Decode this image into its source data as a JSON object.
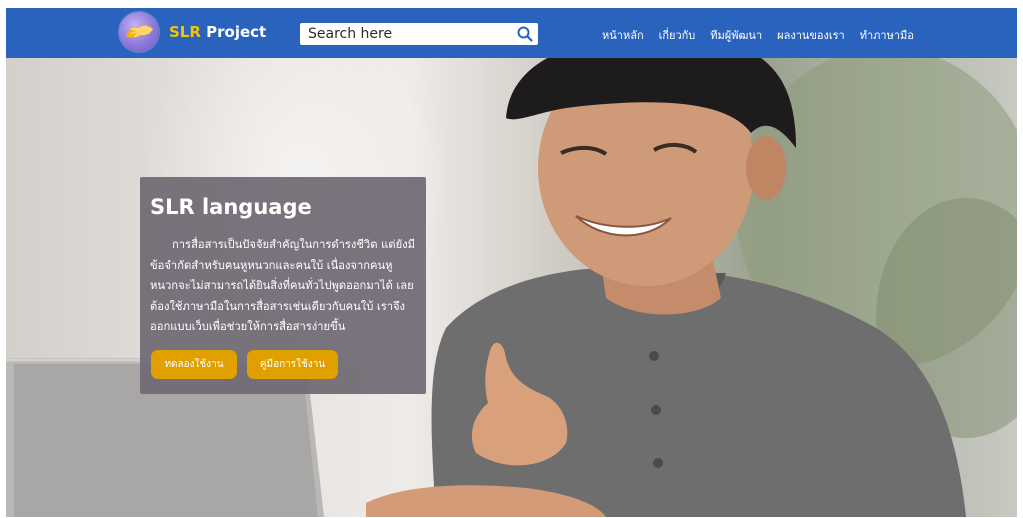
{
  "navbar": {
    "brand_prefix": "SLR",
    "brand_suffix": " Project",
    "search_placeholder": "Search here",
    "links": [
      "หน้าหลัก",
      "เกี่ยวกับ",
      "ทีมผู้พัฒนา",
      "ผลงานของเรา",
      "ทำภาษามือ"
    ]
  },
  "hero": {
    "card": {
      "title": "SLR language",
      "body": "การสื่อสารเป็นปัจจัยสำคัญในการดำรงชีวิต แต่ยังมีข้อจำกัดสำหรับคนหูหนวกและคนใบ้ เนื่องจากคนหูหนวกจะไม่สามารถได้ยินสิ่งที่คนทั่วไปพูดออกมาได้ เลยต้องใช้ภาษามือในการสื่อสารเช่นเดียวกับคนใบ้ เราจึงออกแบบเว็บเพื่อช่วยให้การสื่อสารง่ายขึ้น",
      "try_button": "ทดลองใช้งาน",
      "manual_button": "คู่มือการใช้งาน"
    }
  },
  "colors": {
    "navbar_bg": "#2a63be",
    "brand_accent": "#f5c400",
    "card_bg": "#6f6973",
    "button_bg": "#e0a100"
  },
  "icons": {
    "logo": "sign-language-hands-logo",
    "search": "search-icon"
  }
}
